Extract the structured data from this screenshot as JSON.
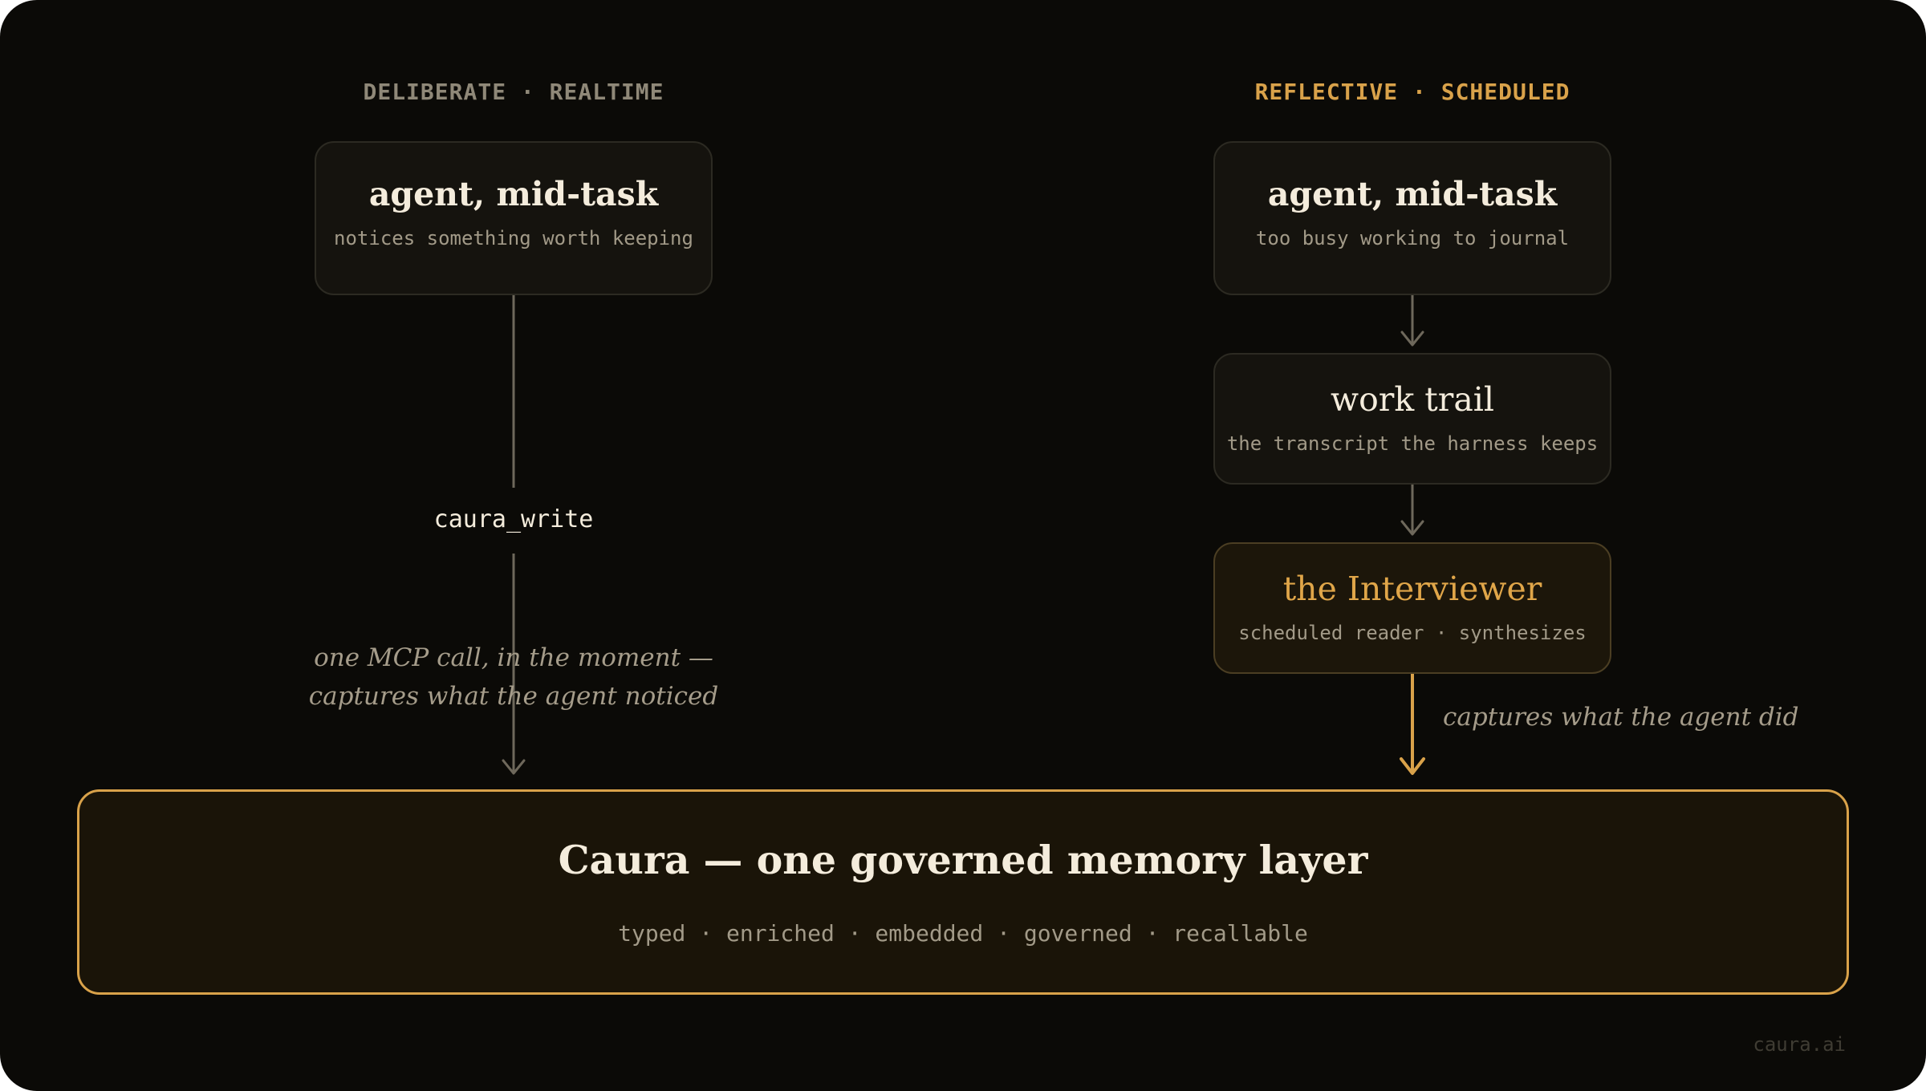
{
  "lanes": {
    "left_label": "DELIBERATE · REALTIME",
    "right_label": "REFLECTIVE · SCHEDULED"
  },
  "left": {
    "agent_title": "agent, mid-task",
    "agent_sub": "notices something worth keeping",
    "call_label": "caura_write",
    "note_line1": "one MCP call, in the moment —",
    "note_line2": "captures what the agent noticed"
  },
  "right": {
    "agent_title": "agent, mid-task",
    "agent_sub": "too busy working to journal",
    "trail_title": "work trail",
    "trail_sub": "the transcript the harness keeps",
    "interviewer_title": "the Interviewer",
    "interviewer_sub": "scheduled reader · synthesizes",
    "note": "captures what the agent did"
  },
  "memory": {
    "title": "Caura — one governed memory layer",
    "sub": "typed · enriched · embedded · governed · recallable"
  },
  "footer": "caura.ai",
  "colors": {
    "background": "#0b0a07",
    "accent": "#d9a24a",
    "arrow_neutral": "#6e685b",
    "text_primary": "#f4ecdc",
    "text_muted": "#a29a88"
  }
}
